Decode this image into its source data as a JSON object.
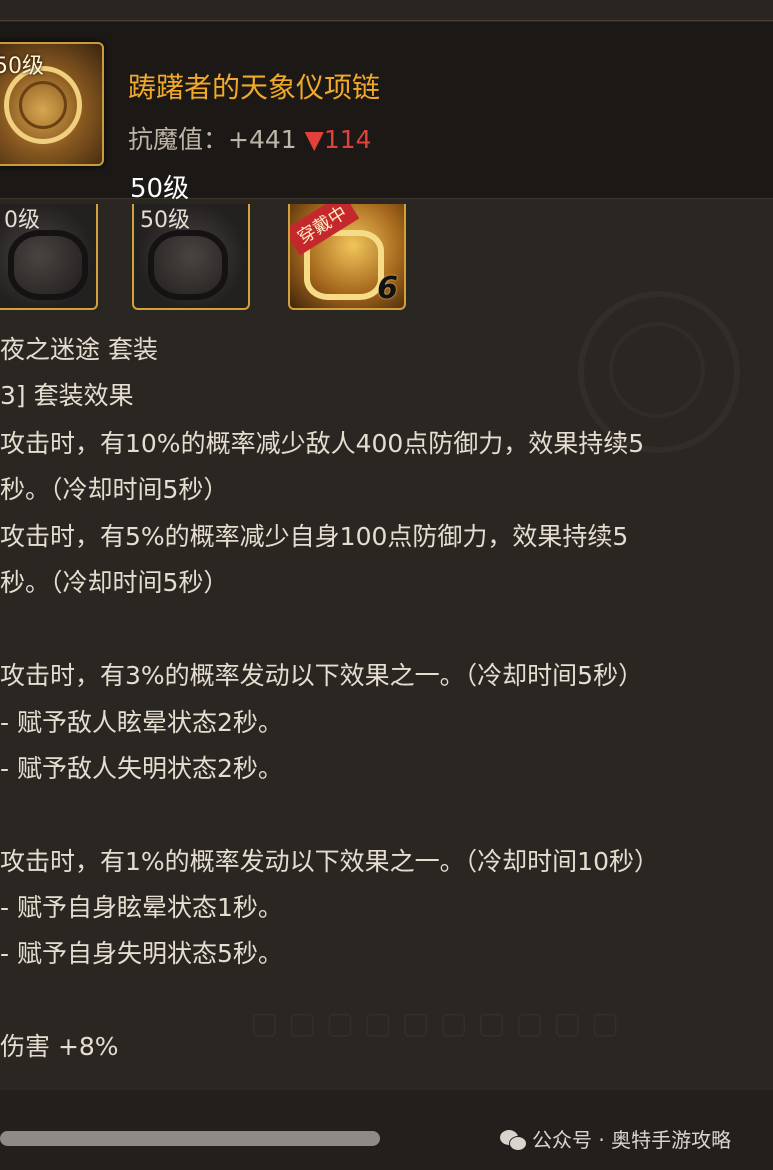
{
  "header": {
    "icon_level": "50级",
    "item_name": "踌躇者的天象仪项链",
    "stat_label": "抗魔值：+441 ",
    "stat_delta": "▼114",
    "level": "50级"
  },
  "set_items": [
    {
      "level": "0级",
      "style": "dark"
    },
    {
      "level": "50级",
      "style": "dark"
    },
    {
      "badge": "穿戴中",
      "count": "6",
      "style": "gold"
    }
  ],
  "description": {
    "lines": [
      "夜之迷途  套装",
      "3] 套装效果",
      "攻击时，有10%的概率减少敌人400点防御力，效果持续5",
      "秒。（冷却时间5秒）",
      "攻击时，有5%的概率减少自身100点防御力，效果持续5",
      "秒。（冷却时间5秒）",
      "攻击时，有3%的概率发动以下效果之一。（冷却时间5秒）",
      "- 赋予敌人眩晕状态2秒。",
      "- 赋予敌人失明状态2秒。",
      "攻击时，有1%的概率发动以下效果之一。（冷却时间10秒）",
      "- 赋予自身眩晕状态1秒。",
      "- 赋予自身失明状态5秒。",
      "伤害 +8%"
    ]
  },
  "watermark": "公众号 · 奥特手游攻略",
  "icons": {
    "watermark_icon": "wechat-icon"
  }
}
